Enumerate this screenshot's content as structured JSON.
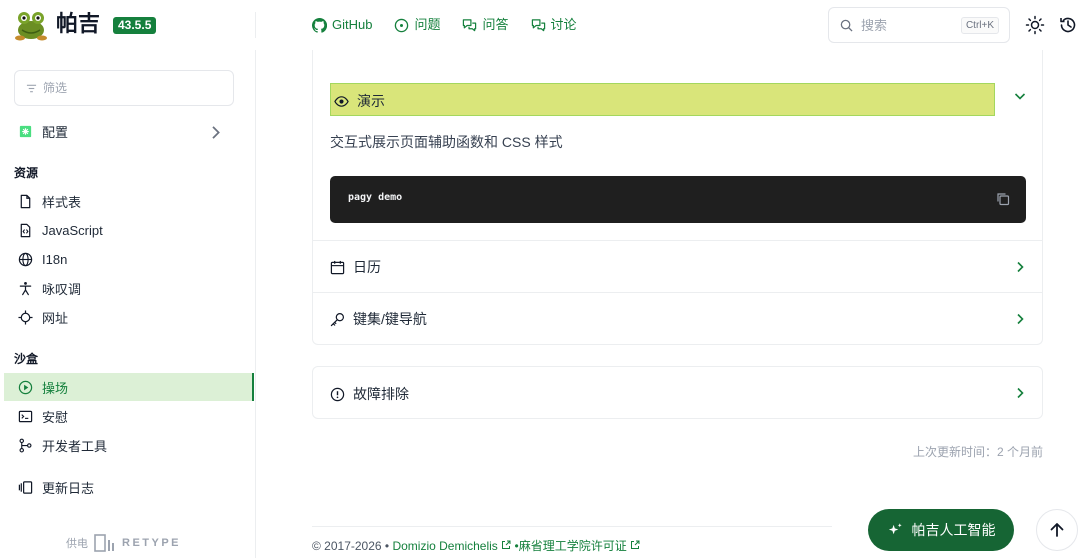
{
  "header": {
    "brand": "帕吉",
    "version": "43.5.5",
    "nav": [
      {
        "label": "GitHub",
        "icon": "github-icon"
      },
      {
        "label": "问题",
        "icon": "issue-icon"
      },
      {
        "label": "问答",
        "icon": "qa-icon"
      },
      {
        "label": "讨论",
        "icon": "discussion-icon"
      }
    ],
    "search": {
      "placeholder": "搜索",
      "shortcut": "Ctrl+K"
    }
  },
  "sidebar": {
    "filter_placeholder": "筛选",
    "config": "配置",
    "section_resources": "资源",
    "resources": [
      "样式表",
      "JavaScript",
      "I18n",
      "咏叹调",
      "网址"
    ],
    "section_sandbox": "沙盒",
    "sandbox": [
      "操场",
      "安慰",
      "开发者工具"
    ],
    "changelog": "更新日志",
    "powered_by": "供电",
    "retype": "RETYPE"
  },
  "main": {
    "demo_title": "演示",
    "demo_desc": "交互式展示页面辅助函数和 CSS 样式",
    "code": "pagy demo",
    "calendar": "日历",
    "keynav": "键集/键导航",
    "troubleshoot": "故障排除",
    "updated": "上次更新时间：2 个月前"
  },
  "footer": {
    "copyright": "© 2017-2026 •",
    "author": "Domizio Demichelis",
    "license": "•麻省理工学院许可证"
  },
  "ai_button": "帕吉人工智能",
  "colors": {
    "accent": "#15803d",
    "highlight": "#d9e57a",
    "ai_button": "#166534"
  }
}
